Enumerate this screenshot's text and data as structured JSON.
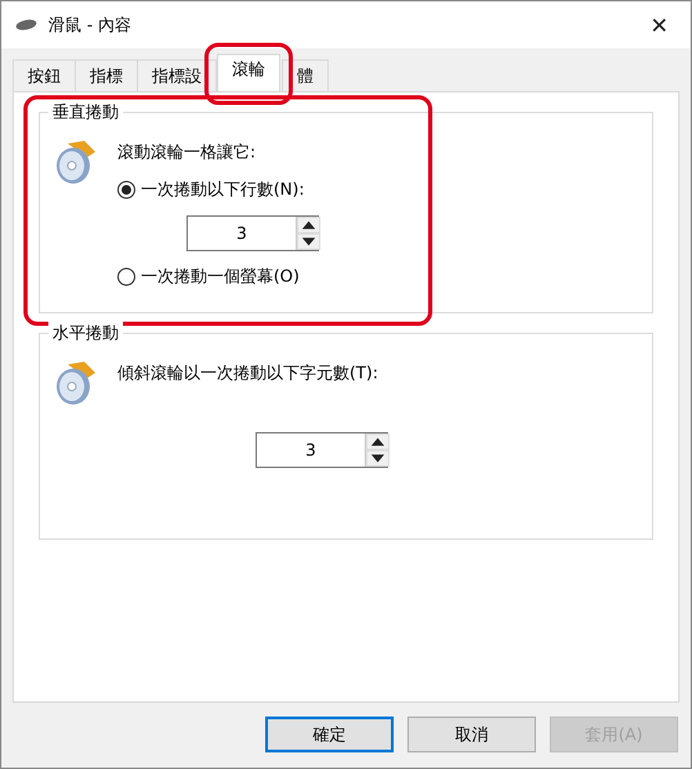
{
  "window": {
    "title": "滑鼠 - 內容",
    "close": "✕"
  },
  "tabs": [
    {
      "label": "按鈕",
      "selected": false,
      "highlighted": false
    },
    {
      "label": "指標",
      "selected": false,
      "highlighted": false
    },
    {
      "label": "指標設",
      "selected": false,
      "highlighted": false
    },
    {
      "label": "滾輪",
      "selected": true,
      "highlighted": true
    },
    {
      "label": "體",
      "selected": false,
      "highlighted": false
    }
  ],
  "groups": [
    {
      "title": "垂直捲動",
      "highlighted": true,
      "prompt": "滾動滾輪一格讓它:",
      "options": [
        {
          "kind": "radio-spin",
          "label": "一次捲動以下行數(N):",
          "selected": true,
          "value": "3"
        },
        {
          "kind": "radio",
          "label": "一次捲動一個螢幕(O)",
          "selected": false
        }
      ]
    },
    {
      "title": "水平捲動",
      "highlighted": false,
      "prompt": "傾斜滾輪以一次捲動以下字元數(T):",
      "options": [
        {
          "kind": "spin",
          "value": "3"
        }
      ]
    }
  ],
  "buttons": [
    {
      "label": "確定",
      "default": true,
      "disabled": false
    },
    {
      "label": "取消",
      "default": false,
      "disabled": false
    },
    {
      "label": "套用(A)",
      "default": false,
      "disabled": true
    }
  ]
}
